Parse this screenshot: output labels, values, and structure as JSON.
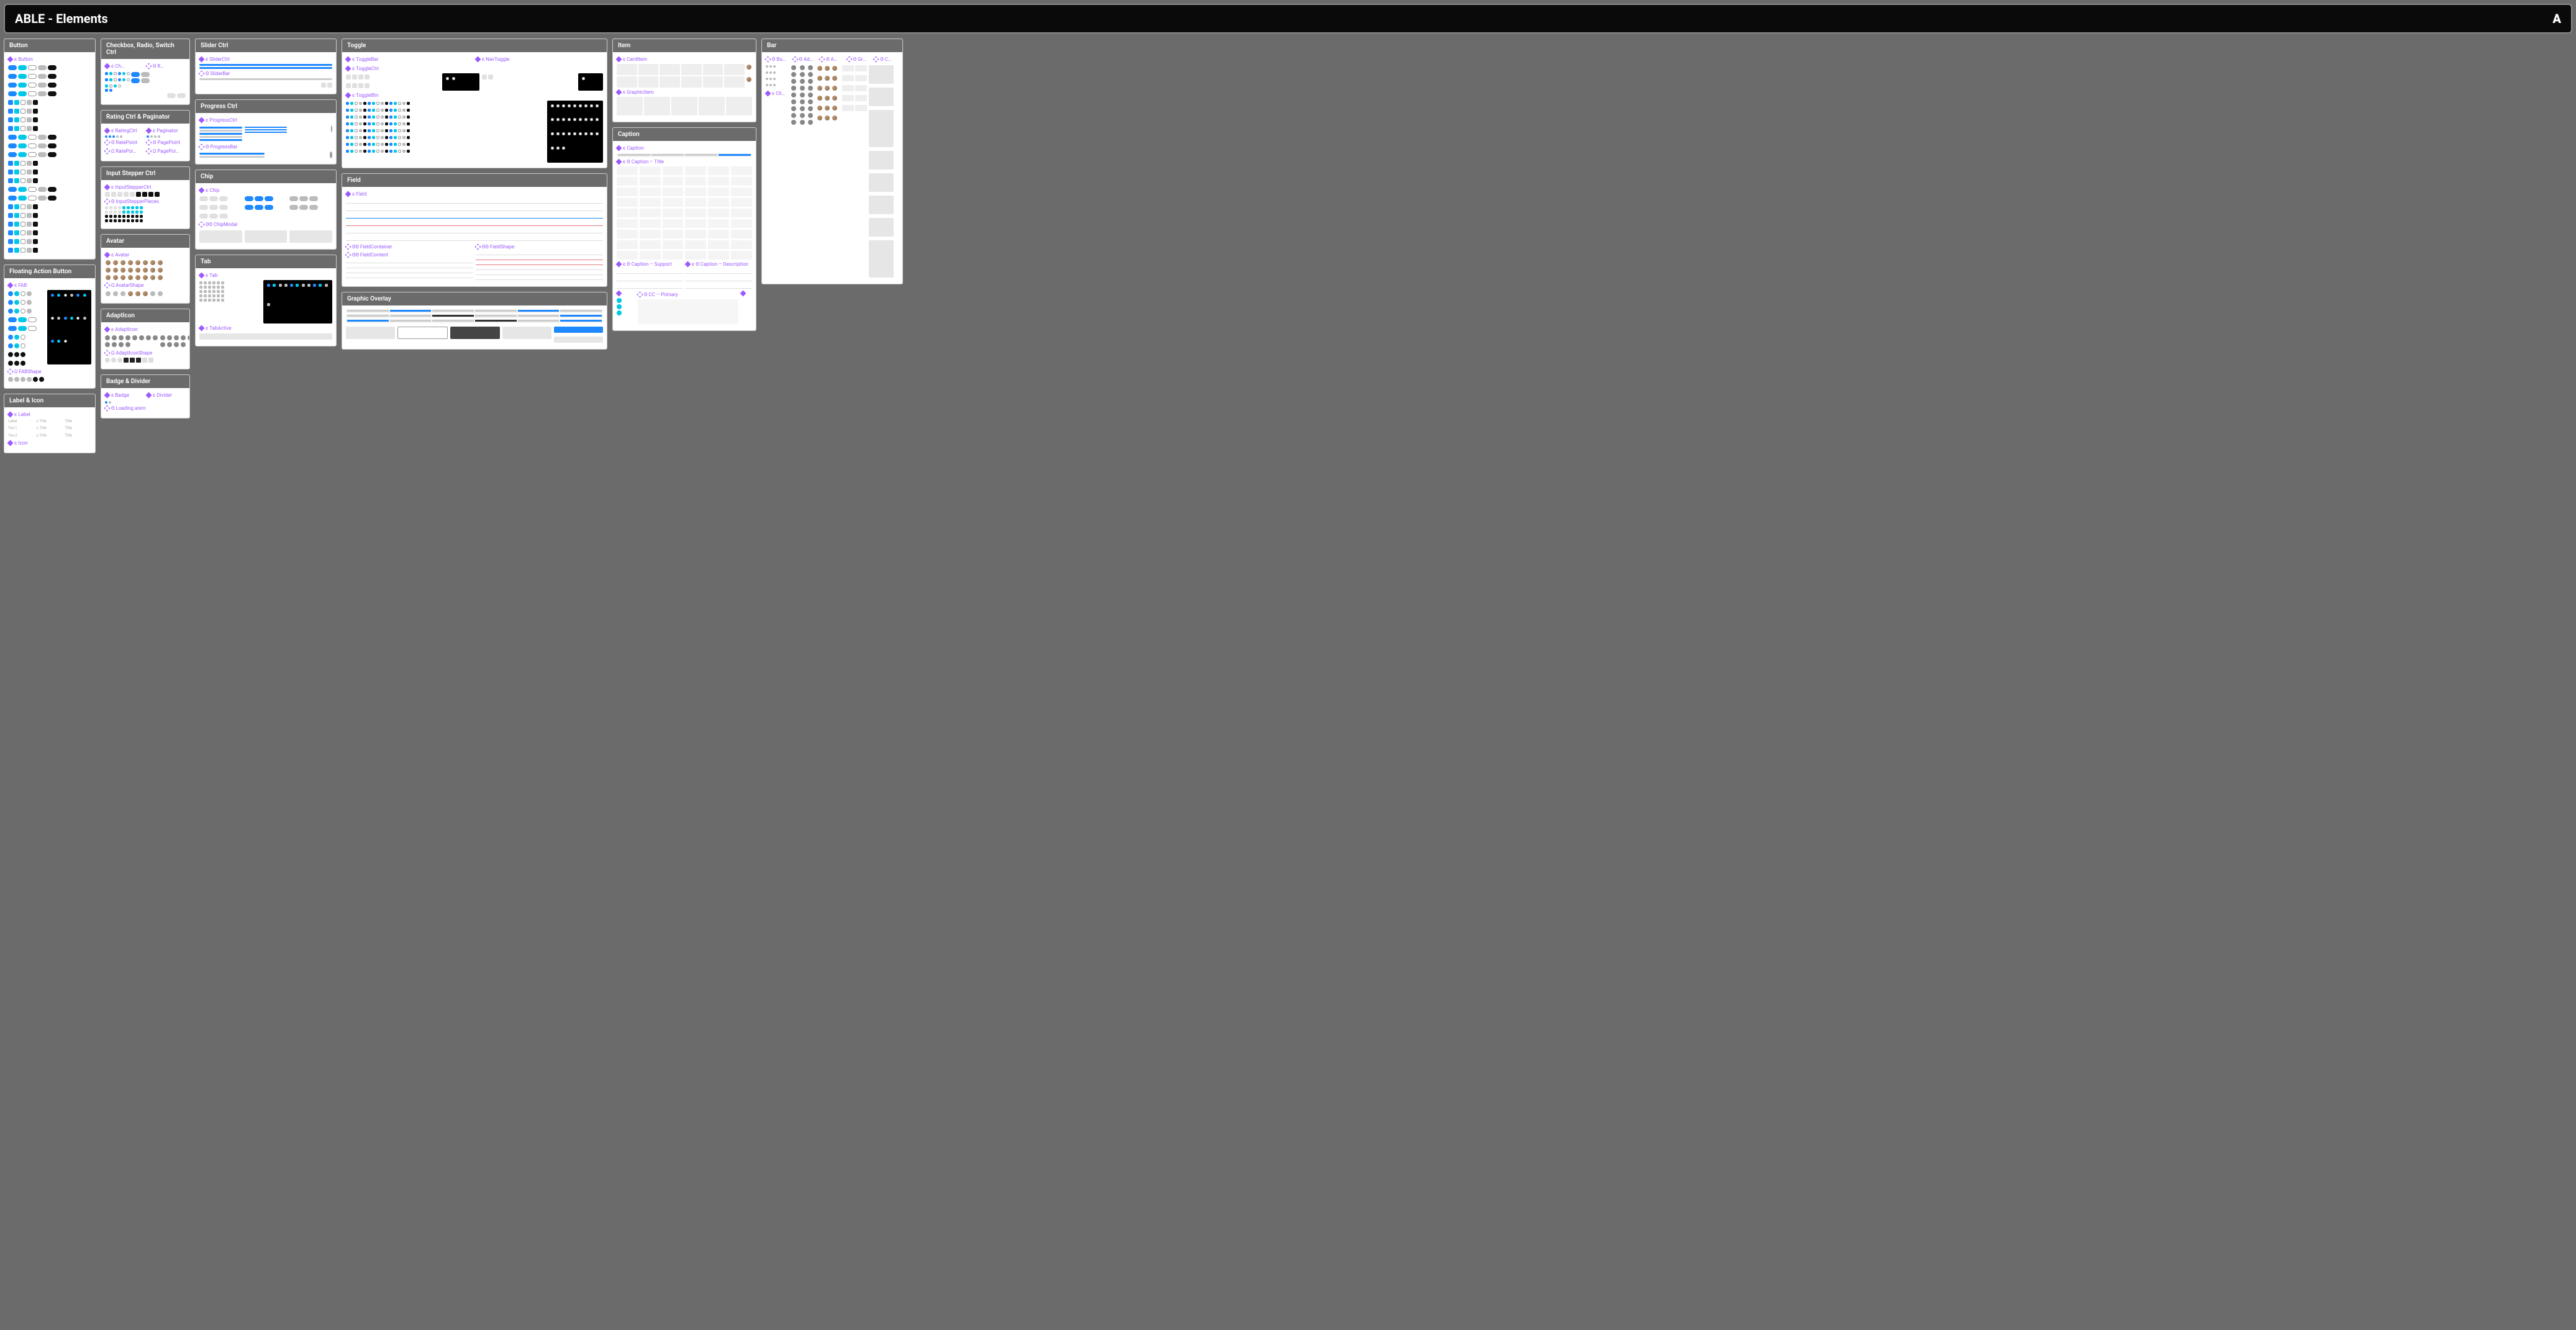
{
  "header": {
    "title": "ABLE - Elements",
    "logo": "A"
  },
  "diamond_prefix": "❖",
  "frames": {
    "button": {
      "title": "Button",
      "components": [
        "ε Button"
      ]
    },
    "fab": {
      "title": "Floating Action Button",
      "components": [
        "ε FAB",
        "Ω FABShape"
      ]
    },
    "label_icon": {
      "title": "Label & Icon",
      "components": [
        "ε Label",
        "ε Icon"
      ],
      "table_cells": [
        "Label",
        "ε Title",
        "Title",
        "Tex-1",
        "ε Title",
        "Title",
        "Tex-2",
        "ε Title",
        "Title"
      ]
    },
    "checkbox": {
      "title": "Checkbox, Radio, Switch Ctrl",
      "components": [
        "ε Ch…",
        "Θ R…"
      ]
    },
    "rating": {
      "title": "Rating Ctrl & Paginator",
      "components": [
        "ε RatingCtrl",
        "ε Paginator",
        "Θ RatePoint",
        "Θ PagePoint",
        "Ω RatePoi…",
        "Ω PagePoi…"
      ]
    },
    "input_stepper": {
      "title": "Input Stepper Ctrl",
      "components": [
        "ε InputStepperCtrl",
        "Θ InputStepperPieces"
      ]
    },
    "avatar": {
      "title": "Avatar",
      "components": [
        "ε Avatar",
        "Ω AvatarShape"
      ]
    },
    "adapticon": {
      "title": "AdaptIcon",
      "components": [
        "ε AdaptIcon",
        "Ω AdaptIconShape"
      ]
    },
    "badge": {
      "title": "Badge & Divider",
      "components": [
        "ε Badge",
        "ε Divider",
        "Θ Loading anim"
      ]
    },
    "slider": {
      "title": "Slider Ctrl",
      "components": [
        "ε SliderCtrl",
        "Θ SliderBar"
      ]
    },
    "progress": {
      "title": "Progress Ctrl",
      "components": [
        "ε ProgressCtrl",
        "Θ ProgressBar"
      ]
    },
    "chip": {
      "title": "Chip",
      "components": [
        "ε Chip",
        "ΘΘ ChipModal"
      ]
    },
    "tab": {
      "title": "Tab",
      "components": [
        "ε Tab",
        "ε TabActive"
      ]
    },
    "toggle": {
      "title": "Toggle",
      "components": [
        "ε ToggleBar",
        "ε NavToggle",
        "ε ToggleCtrl",
        "ε ToggleBtn"
      ]
    },
    "field": {
      "title": "Field",
      "components": [
        "ε Field",
        "ΘΘ  FieldContainer",
        "ΘΘ FieldShape",
        "ΘΘ  FieldContent"
      ]
    },
    "graphic_overlay": {
      "title": "Graphic Overlay"
    },
    "item": {
      "title": "Item",
      "components": [
        "ε CardItem",
        "ε GraphicItem"
      ]
    },
    "caption": {
      "title": "Caption",
      "components": [
        "ε Caption",
        "ε Θ Caption – Title",
        "ε Θ Caption – Support",
        "ε Θ Caption – Description",
        "Θ CC – Primary"
      ]
    },
    "bar": {
      "title": "Bar",
      "components": [
        "Θ Bu…",
        "Θ Ad…",
        "Θ A…",
        "Θ Gr…",
        "Θ C…",
        "ε Ch…"
      ]
    }
  }
}
